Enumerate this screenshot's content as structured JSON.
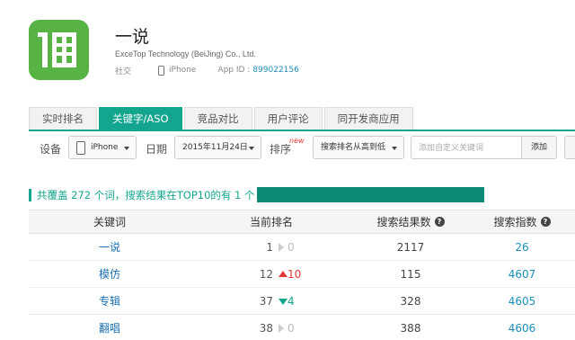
{
  "app": {
    "name": "一说",
    "developer": "ExceTop Technology (BeiJing) Co., Ltd.",
    "category": "社交",
    "device": "iPhone",
    "app_id_label": "App ID :",
    "app_id": "899022156",
    "icon": "yishuo-app-logo",
    "icon_color": "#56b344"
  },
  "tabs": [
    {
      "label": "实时排名",
      "active": false
    },
    {
      "label": "关键字/ASO",
      "active": true
    },
    {
      "label": "竞品对比",
      "active": false
    },
    {
      "label": "用户评论",
      "active": false
    },
    {
      "label": "同开发商应用",
      "active": false
    }
  ],
  "filters": {
    "device_label": "设备",
    "device_value": "iPhone",
    "date_label": "日期",
    "date_value": "2015年11月24日",
    "sort_label": "排序",
    "sort_badge": "new",
    "sort_value": "搜索排名从高到低",
    "keyword_placeholder": "添加自定义关键词",
    "add_button": "添加"
  },
  "summary": {
    "text": "共覆盖 272 个词，搜索结果在TOP10的有 1 个"
  },
  "table": {
    "headers": {
      "keyword": "关键词",
      "rank": "当前排名",
      "results": "搜索结果数",
      "index": "搜索指数"
    },
    "rows": [
      {
        "keyword": "一说",
        "rank": "1",
        "trend": "flat",
        "change": "0",
        "results": "2117",
        "index": "26"
      },
      {
        "keyword": "模仿",
        "rank": "12",
        "trend": "up",
        "change": "10",
        "results": "115",
        "index": "4607"
      },
      {
        "keyword": "专辑",
        "rank": "37",
        "trend": "down",
        "change": "4",
        "results": "328",
        "index": "4605"
      },
      {
        "keyword": "翻唱",
        "rank": "38",
        "trend": "flat",
        "change": "0",
        "results": "388",
        "index": "4606"
      }
    ]
  },
  "colors": {
    "accent": "#13a58e",
    "summary_bar": "#0e8a78",
    "up": "#e53935",
    "link": "#1a8fb8"
  }
}
